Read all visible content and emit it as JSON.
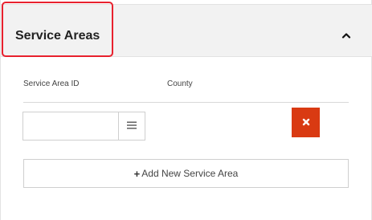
{
  "panel": {
    "title": "Service Areas",
    "collapse_icon": "chevron-up-icon"
  },
  "table": {
    "columns": [
      "Service Area ID",
      "County"
    ],
    "rows": [
      {
        "service_area_id": "",
        "county": ""
      }
    ]
  },
  "icons": {
    "lookup": "list-icon",
    "remove": "times-icon",
    "add": "plus-icon"
  },
  "actions": {
    "add_label": "Add New Service Area",
    "add_symbol": "+"
  },
  "colors": {
    "highlight_border": "#e8212e",
    "remove_button": "#d93a12",
    "header_bg": "#f2f2f2"
  }
}
